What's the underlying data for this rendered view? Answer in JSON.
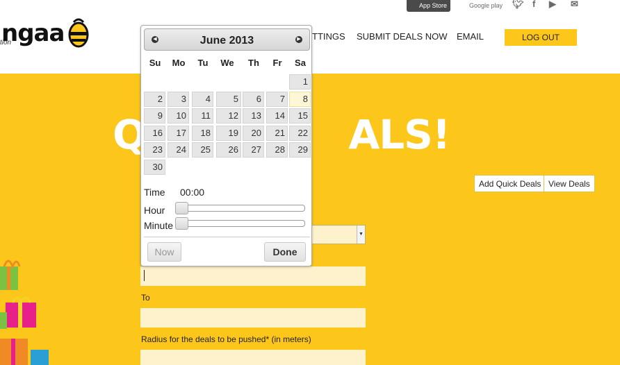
{
  "brand": {
    "logo_text": "ngaa",
    "tagline": "tion"
  },
  "top_links": {
    "app_store": "App Store",
    "google_play": "Google play"
  },
  "nav": {
    "settings": "TTINGS",
    "submit_deals": "SUBMIT DEALS NOW",
    "email": "EMAIL",
    "logout": "LOG OUT"
  },
  "main": {
    "title_left": "Q",
    "title_right": "ALS!",
    "add_quick_deals": "Add Quick Deals",
    "view_deals": "View Deals",
    "to_label": "To",
    "radius_label": "Radius for the deals to be pushed* (in meters)"
  },
  "datepicker": {
    "month_title": "June 2013",
    "weekdays": [
      "Su",
      "Mo",
      "Tu",
      "We",
      "Th",
      "Fr",
      "Sa"
    ],
    "days": [
      "1",
      "2",
      "3",
      "4",
      "5",
      "6",
      "7",
      "8",
      "9",
      "10",
      "11",
      "12",
      "13",
      "14",
      "15",
      "16",
      "17",
      "18",
      "19",
      "20",
      "21",
      "22",
      "23",
      "24",
      "25",
      "26",
      "27",
      "28",
      "29",
      "30"
    ],
    "highlighted_day": "8",
    "time_label": "Time",
    "time_value": "00:00",
    "hour_label": "Hour",
    "minute_label": "Minute",
    "hour_value": 0,
    "minute_value": 0,
    "now_button": "Now",
    "done_button": "Done"
  },
  "colors": {
    "accent": "#fcc61a",
    "field_bg": "#fdf2cc",
    "header_bg": "#ffffff"
  }
}
